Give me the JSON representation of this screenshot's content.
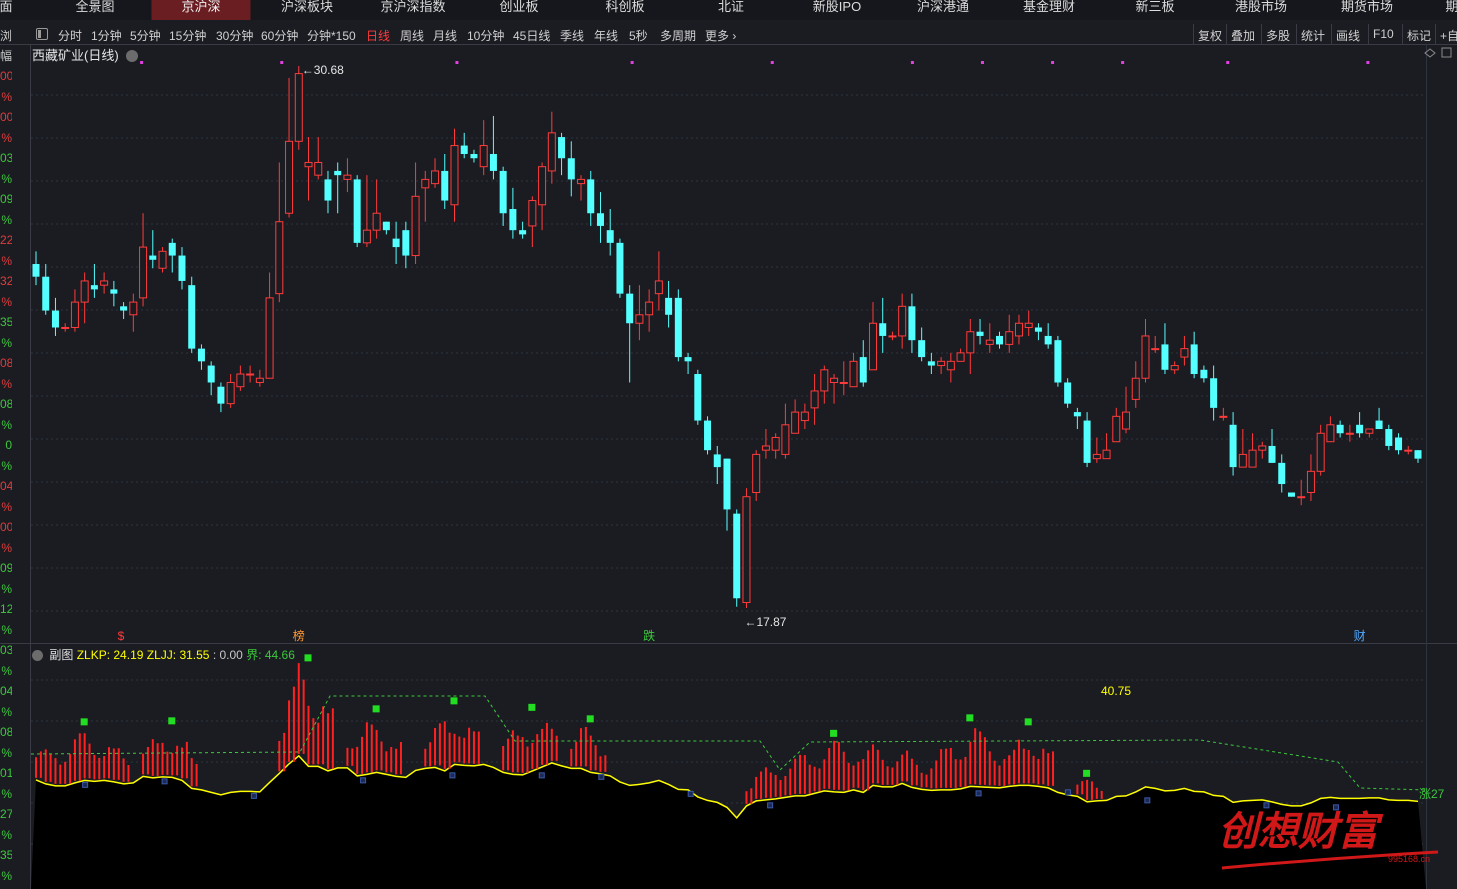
{
  "nav": {
    "partial_left": "面",
    "items": [
      "全景图",
      "京沪深",
      "沪深板块",
      "京沪深指数",
      "创业板",
      "科创板",
      "北证",
      "新股IPO",
      "沪深港通",
      "基金理财",
      "新三板",
      "港股市场",
      "期货市场"
    ],
    "active_index": 1,
    "partial_right": "期"
  },
  "periods": [
    "分时",
    "1分钟",
    "5分钟",
    "15分钟",
    "30分钟",
    "60分钟",
    "分钟*150",
    "日线",
    "周线",
    "月线",
    "10分钟",
    "45日线",
    "季线",
    "年线",
    "5秒",
    "多周期",
    "更多"
  ],
  "active_period": "日线",
  "tools": [
    "复权",
    "叠加",
    "多股",
    "统计",
    "画线",
    "F10",
    "标记",
    "+自"
  ],
  "left_partial_header": [
    "幅",
    "浏览"
  ],
  "left_partial_labels": [
    {
      "t": "00",
      "c": "#e03c3c"
    },
    {
      "t": "%",
      "c": "#e03c3c"
    },
    {
      "t": "00",
      "c": "#e03c3c"
    },
    {
      "t": "%",
      "c": "#e03c3c"
    },
    {
      "t": "03",
      "c": "#3cc83c"
    },
    {
      "t": "%",
      "c": "#3cc83c"
    },
    {
      "t": "09",
      "c": "#3cc83c"
    },
    {
      "t": "%",
      "c": "#3cc83c"
    },
    {
      "t": "22",
      "c": "#e03c3c"
    },
    {
      "t": "%",
      "c": "#e03c3c"
    },
    {
      "t": "32",
      "c": "#e03c3c"
    },
    {
      "t": "%",
      "c": "#e03c3c"
    },
    {
      "t": "35",
      "c": "#3cc83c"
    },
    {
      "t": "%",
      "c": "#3cc83c"
    },
    {
      "t": "08",
      "c": "#e03c3c"
    },
    {
      "t": "%",
      "c": "#e03c3c"
    },
    {
      "t": "08",
      "c": "#3cc83c"
    },
    {
      "t": "%",
      "c": "#3cc83c"
    },
    {
      "t": "0",
      "c": "#3cc83c"
    },
    {
      "t": "%",
      "c": "#3cc83c"
    },
    {
      "t": "04",
      "c": "#e03c3c"
    },
    {
      "t": "%",
      "c": "#e03c3c"
    },
    {
      "t": "00",
      "c": "#e03c3c"
    },
    {
      "t": "%",
      "c": "#e03c3c"
    },
    {
      "t": "09",
      "c": "#3cc83c"
    },
    {
      "t": "%",
      "c": "#3cc83c"
    },
    {
      "t": "12",
      "c": "#3cc83c"
    },
    {
      "t": "%",
      "c": "#3cc83c"
    },
    {
      "t": "03",
      "c": "#3cc83c"
    },
    {
      "t": "%",
      "c": "#3cc83c"
    },
    {
      "t": "04",
      "c": "#3cc83c"
    },
    {
      "t": "%",
      "c": "#3cc83c"
    },
    {
      "t": "08",
      "c": "#3cc83c"
    },
    {
      "t": "%",
      "c": "#3cc83c"
    },
    {
      "t": "01",
      "c": "#3cc83c"
    },
    {
      "t": "%",
      "c": "#3cc83c"
    },
    {
      "t": "27",
      "c": "#3cc83c"
    },
    {
      "t": "%",
      "c": "#3cc83c"
    },
    {
      "t": "35",
      "c": "#3cc83c"
    },
    {
      "t": "%",
      "c": "#3cc83c"
    }
  ],
  "stock_title": "西藏矿业(日线)",
  "colors": {
    "up": "#ff3b3b",
    "down": "#54ffff",
    "grid": "#2e3340",
    "bg": "#1b1c22",
    "signal": "#e040e0",
    "zlkp": "#ffff00",
    "zljj": "#ffff00",
    "jie": "#3cc83c"
  },
  "chart_data": {
    "type": "candlestick",
    "high_label": "30.68",
    "low_label": "17.87",
    "candles": [
      [
        26.0,
        25.7,
        26.3,
        25.5
      ],
      [
        25.7,
        24.9,
        26.0,
        24.8
      ],
      [
        24.9,
        24.5,
        25.2,
        24.3
      ],
      [
        24.5,
        24.5,
        24.6,
        24.4
      ],
      [
        24.5,
        25.1,
        25.4,
        24.4
      ],
      [
        25.1,
        25.6,
        25.8,
        24.6
      ],
      [
        25.5,
        25.4,
        26.0,
        25.2
      ],
      [
        25.5,
        25.6,
        25.8,
        25.3
      ],
      [
        25.4,
        25.3,
        25.6,
        25.0
      ],
      [
        25.0,
        24.9,
        25.1,
        24.7
      ],
      [
        24.8,
        25.1,
        25.3,
        24.4
      ],
      [
        25.2,
        26.4,
        27.2,
        25.0
      ],
      [
        26.2,
        26.1,
        26.8,
        25.9
      ],
      [
        25.9,
        26.3,
        26.4,
        25.8
      ],
      [
        26.5,
        26.2,
        26.6,
        25.8
      ],
      [
        26.2,
        25.6,
        26.4,
        25.4
      ],
      [
        25.5,
        24.0,
        25.7,
        23.9
      ],
      [
        24.0,
        23.7,
        24.1,
        23.5
      ],
      [
        23.6,
        23.2,
        23.7,
        22.9
      ],
      [
        23.1,
        22.7,
        23.2,
        22.5
      ],
      [
        22.7,
        23.2,
        23.4,
        22.6
      ],
      [
        23.1,
        23.4,
        23.6,
        23.0
      ],
      [
        23.4,
        23.4,
        23.6,
        23.2
      ],
      [
        23.2,
        23.3,
        23.5,
        23.1
      ],
      [
        23.3,
        25.2,
        25.8,
        23.3
      ],
      [
        25.3,
        27.0,
        28.4,
        25.1
      ],
      [
        27.2,
        28.9,
        30.4,
        27.1
      ],
      [
        28.9,
        30.5,
        30.68,
        28.7
      ],
      [
        28.3,
        28.4,
        29.0,
        27.5
      ],
      [
        28.1,
        28.4,
        29.0,
        28.0
      ],
      [
        28.0,
        27.5,
        28.2,
        27.2
      ],
      [
        28.2,
        28.1,
        28.4,
        27.2
      ],
      [
        28.0,
        28.1,
        28.5,
        27.7
      ],
      [
        28.0,
        26.5,
        28.1,
        26.4
      ],
      [
        26.5,
        26.8,
        28.1,
        26.4
      ],
      [
        26.8,
        27.2,
        28.0,
        26.6
      ],
      [
        27.0,
        26.8,
        27.0,
        26.7
      ],
      [
        26.6,
        26.4,
        27.0,
        26.0
      ],
      [
        26.8,
        26.2,
        27.0,
        25.9
      ],
      [
        26.2,
        27.6,
        28.4,
        26.0
      ],
      [
        27.8,
        28.0,
        28.2,
        27.0
      ],
      [
        27.9,
        28.2,
        28.5,
        27.8
      ],
      [
        28.2,
        27.5,
        28.6,
        27.3
      ],
      [
        27.4,
        28.8,
        29.2,
        27.0
      ],
      [
        28.8,
        28.6,
        29.1,
        28.5
      ],
      [
        28.6,
        28.5,
        28.7,
        28.4
      ],
      [
        28.3,
        28.8,
        29.4,
        28.1
      ],
      [
        28.6,
        28.2,
        29.5,
        28.0
      ],
      [
        28.2,
        27.2,
        28.3,
        26.9
      ],
      [
        27.3,
        26.8,
        27.8,
        26.6
      ],
      [
        26.8,
        26.7,
        27.0,
        26.6
      ],
      [
        26.9,
        27.5,
        27.6,
        26.4
      ],
      [
        27.4,
        28.3,
        28.4,
        26.8
      ],
      [
        28.2,
        29.1,
        29.6,
        27.9
      ],
      [
        29.0,
        28.5,
        29.1,
        28.1
      ],
      [
        28.5,
        28.0,
        28.9,
        27.6
      ],
      [
        27.9,
        28.0,
        28.1,
        27.5
      ],
      [
        28.0,
        27.2,
        28.2,
        26.9
      ],
      [
        27.2,
        26.9,
        27.7,
        26.5
      ],
      [
        26.8,
        26.5,
        27.3,
        26.2
      ],
      [
        26.5,
        25.3,
        26.6,
        25.2
      ],
      [
        25.3,
        24.6,
        25.5,
        23.2
      ],
      [
        24.6,
        24.8,
        25.5,
        24.2
      ],
      [
        24.8,
        25.1,
        25.4,
        24.4
      ],
      [
        25.3,
        25.6,
        26.3,
        24.9
      ],
      [
        25.2,
        24.8,
        25.6,
        24.5
      ],
      [
        25.2,
        23.8,
        25.4,
        23.7
      ],
      [
        23.8,
        23.7,
        23.9,
        23.4
      ],
      [
        23.4,
        22.3,
        23.5,
        22.2
      ],
      [
        22.3,
        21.6,
        22.4,
        21.5
      ],
      [
        21.5,
        21.2,
        21.7,
        20.8
      ],
      [
        21.4,
        20.2,
        21.4,
        19.7
      ],
      [
        20.1,
        18.1,
        20.2,
        17.9
      ],
      [
        18.0,
        20.5,
        20.7,
        17.87
      ],
      [
        20.6,
        21.5,
        21.6,
        20.4
      ],
      [
        21.6,
        21.7,
        22.1,
        21.4
      ],
      [
        21.6,
        21.9,
        22.0,
        21.4
      ],
      [
        21.5,
        22.2,
        22.7,
        21.4
      ],
      [
        22.0,
        22.5,
        22.8,
        22.0
      ],
      [
        22.3,
        22.5,
        22.7,
        22.1
      ],
      [
        22.6,
        23.0,
        23.4,
        22.2
      ],
      [
        23.0,
        23.5,
        23.6,
        22.7
      ],
      [
        23.2,
        23.3,
        23.4,
        22.7
      ],
      [
        23.2,
        23.2,
        23.7,
        22.9
      ],
      [
        23.1,
        23.7,
        23.9,
        23.1
      ],
      [
        23.8,
        23.2,
        24.2,
        23.1
      ],
      [
        23.5,
        24.6,
        25.1,
        23.5
      ],
      [
        24.6,
        24.3,
        25.2,
        23.9
      ],
      [
        24.3,
        24.3,
        24.4,
        24.2
      ],
      [
        24.3,
        25.0,
        25.3,
        24.0
      ],
      [
        25.0,
        24.2,
        25.3,
        23.9
      ],
      [
        24.2,
        23.8,
        24.5,
        23.7
      ],
      [
        23.7,
        23.6,
        23.9,
        23.4
      ],
      [
        23.6,
        23.7,
        23.8,
        23.4
      ],
      [
        23.5,
        23.7,
        23.9,
        23.2
      ],
      [
        23.7,
        23.9,
        24.0,
        23.7
      ],
      [
        23.9,
        24.4,
        24.7,
        23.4
      ],
      [
        24.4,
        24.3,
        24.7,
        24.1
      ],
      [
        24.1,
        24.2,
        24.6,
        23.9
      ],
      [
        24.3,
        24.1,
        24.4,
        24.0
      ],
      [
        24.1,
        24.4,
        24.8,
        23.9
      ],
      [
        24.3,
        24.6,
        24.8,
        24.1
      ],
      [
        24.5,
        24.6,
        24.9,
        24.3
      ],
      [
        24.5,
        24.4,
        24.6,
        24.2
      ],
      [
        24.3,
        24.1,
        24.6,
        24.0
      ],
      [
        24.2,
        23.2,
        24.3,
        23.1
      ],
      [
        23.2,
        22.7,
        23.3,
        22.6
      ],
      [
        22.5,
        22.4,
        22.6,
        22.1
      ],
      [
        22.3,
        21.3,
        22.5,
        21.2
      ],
      [
        21.4,
        21.5,
        21.9,
        21.3
      ],
      [
        21.4,
        21.6,
        22.0,
        21.5
      ],
      [
        21.8,
        22.4,
        22.6,
        21.8
      ],
      [
        22.1,
        22.5,
        23.1,
        22.0
      ],
      [
        22.8,
        23.3,
        23.7,
        22.6
      ],
      [
        23.3,
        24.3,
        24.7,
        23.2
      ],
      [
        24.0,
        24.0,
        24.3,
        23.9
      ],
      [
        24.1,
        23.5,
        24.6,
        23.4
      ],
      [
        23.5,
        23.6,
        23.7,
        23.4
      ],
      [
        23.8,
        24.0,
        24.3,
        23.6
      ],
      [
        24.1,
        23.4,
        24.4,
        23.3
      ],
      [
        23.5,
        23.3,
        23.6,
        23.2
      ],
      [
        23.3,
        22.6,
        23.6,
        22.3
      ],
      [
        22.4,
        22.4,
        22.6,
        22.3
      ],
      [
        22.2,
        21.2,
        22.5,
        21.0
      ],
      [
        21.2,
        21.5,
        22.1,
        21.2
      ],
      [
        21.2,
        21.6,
        22.0,
        21.2
      ],
      [
        21.6,
        21.7,
        21.8,
        21.4
      ],
      [
        21.7,
        21.3,
        22.1,
        21.3
      ],
      [
        21.3,
        20.8,
        21.5,
        20.6
      ],
      [
        20.6,
        20.5,
        20.6,
        20.5
      ],
      [
        20.5,
        20.5,
        20.9,
        20.3
      ],
      [
        20.6,
        21.1,
        21.5,
        20.4
      ],
      [
        21.1,
        22.0,
        22.2,
        21.0
      ],
      [
        21.8,
        22.2,
        22.4,
        21.8
      ],
      [
        22.2,
        22.0,
        22.3,
        21.9
      ],
      [
        22.0,
        22.0,
        22.2,
        21.8
      ],
      [
        22.2,
        22.0,
        22.5,
        21.9
      ],
      [
        22.0,
        22.1,
        22.1,
        21.9
      ],
      [
        22.3,
        22.1,
        22.6,
        22.1
      ],
      [
        22.1,
        21.7,
        22.2,
        21.6
      ],
      [
        21.9,
        21.6,
        22.0,
        21.5
      ],
      [
        21.6,
        21.6,
        21.7,
        21.5
      ],
      [
        21.6,
        21.4,
        21.6,
        21.3
      ]
    ],
    "event_marks": [
      {
        "i": 9,
        "text": "$",
        "color": "#ff3b3b"
      },
      {
        "i": 27,
        "text": "榜",
        "color": "#ff9933"
      },
      {
        "i": 63,
        "text": "跌",
        "color": "#3cc83c"
      },
      {
        "i": 136,
        "text": "财",
        "color": "#4fa8ff"
      }
    ],
    "signal_dots": [
      3,
      7,
      12,
      17,
      21,
      25,
      27,
      29,
      31,
      34,
      38,
      43,
      46,
      51,
      55,
      61,
      68,
      75,
      130,
      135,
      139,
      142
    ]
  },
  "sub_chart": {
    "name": "副图",
    "zlkp_label": "ZLKP: 24.19",
    "zljj_label": "ZLJJ: 31.55",
    "zero_label": ": 0.00",
    "jie_label": "界: 44.66",
    "value_label": "40.75",
    "edge_label": "涨27"
  },
  "watermark": {
    "text": "创想财富",
    "url": "995168.cn"
  }
}
